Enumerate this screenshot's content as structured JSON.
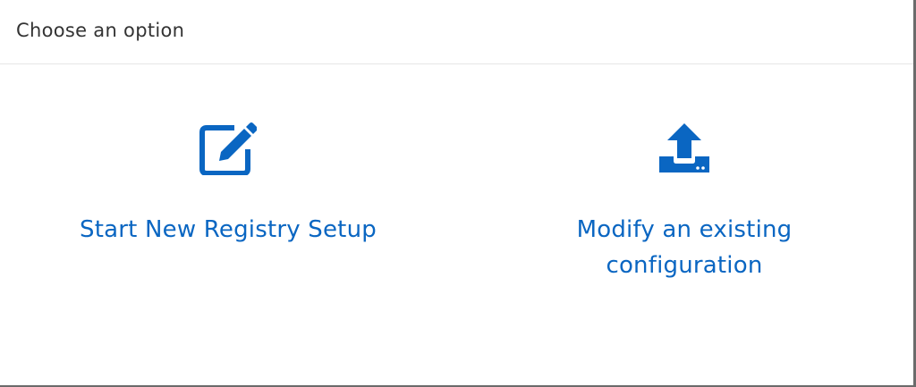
{
  "header": {
    "title": "Choose an option"
  },
  "options": [
    {
      "icon": "edit-icon",
      "label_lines": [
        "Start New Registry Setup"
      ]
    },
    {
      "icon": "upload-icon",
      "label_lines": [
        "Modify an existing",
        "configuration"
      ]
    }
  ],
  "colors": {
    "accent": "#0a66c2",
    "header_text": "#333333",
    "divider": "#e6e6e6",
    "background": "#ffffff"
  }
}
